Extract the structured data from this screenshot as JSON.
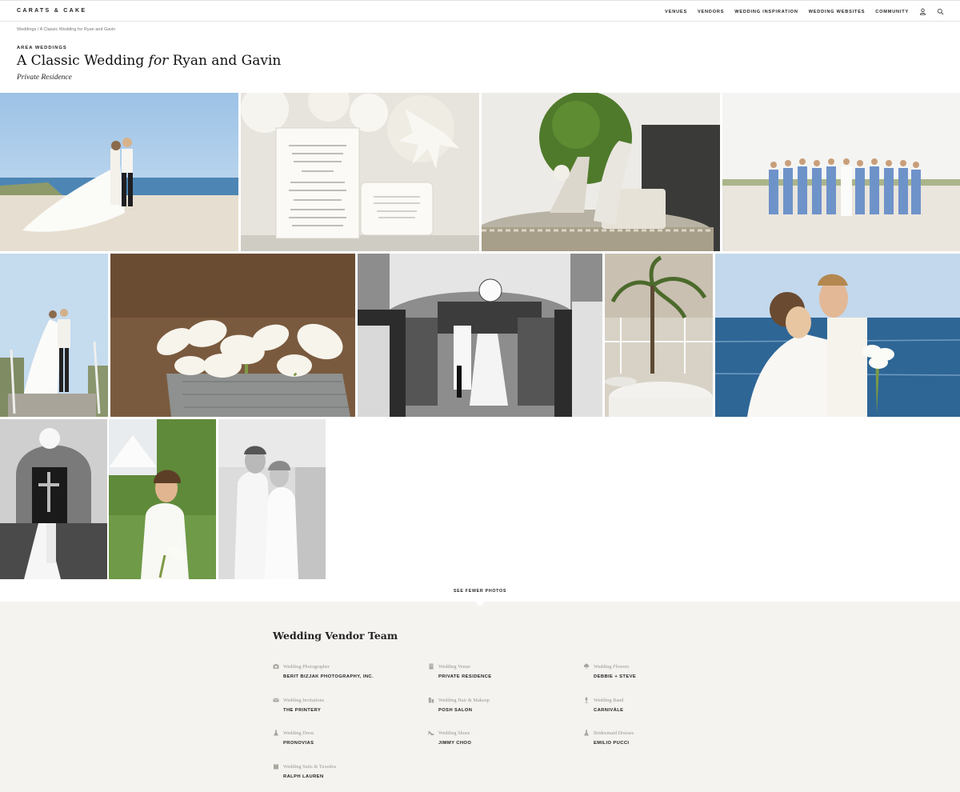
{
  "header": {
    "logo": "CARATS & CAKE",
    "nav": [
      "VENUES",
      "VENDORS",
      "WEDDING INSPIRATION",
      "WEDDING WEBSITES",
      "COMMUNITY"
    ],
    "icons": [
      "user-icon",
      "search-icon"
    ]
  },
  "breadcrumb": {
    "root": "Weddings",
    "separator": "/",
    "current": "A Classic Wedding for Ryan and Gavin"
  },
  "article": {
    "kicker": "AREA WEDDINGS",
    "title_before": "A Classic Wedding ",
    "title_italic": "for",
    "title_after": " Ryan and Gavin",
    "location": "Private Residence"
  },
  "gallery": {
    "toggle_label": "SEE FEWER PHOTOS",
    "photos": [
      "beach couple with flowing cape",
      "wedding invitation suite with coral",
      "embellished heels on mirrored tray",
      "bridesmaids in blue dresses on beach",
      "couple on beach stairs",
      "white calla lily bouquet",
      "black and white church recessional",
      "tent reception tables with palm",
      "couple kissing by the ocean",
      "black and white church altar",
      "bride portrait in garden",
      "black and white couple dancing"
    ]
  },
  "vendors": {
    "heading": "Wedding Vendor Team",
    "items": [
      {
        "role": "Wedding Photographer",
        "name": "BERIT BIZJAK PHOTOGRAPHY, INC.",
        "icon": "camera-icon"
      },
      {
        "role": "Wedding Venue",
        "name": "PRIVATE RESIDENCE",
        "icon": "building-icon"
      },
      {
        "role": "Wedding Flowers",
        "name": "DEBBIE + STEVE",
        "icon": "flower-icon"
      },
      {
        "role": "Wedding Invitations",
        "name": "THE PRINTERY",
        "icon": "envelope-icon"
      },
      {
        "role": "Wedding Hair & Makeup",
        "name": "POSH SALON",
        "icon": "makeup-icon"
      },
      {
        "role": "Wedding Band",
        "name": "CARNIVÀLE",
        "icon": "microphone-icon"
      },
      {
        "role": "Wedding Dress",
        "name": "PRONOVIAS",
        "icon": "dress-icon"
      },
      {
        "role": "Wedding Shoes",
        "name": "JIMMY CHOO",
        "icon": "shoe-icon"
      },
      {
        "role": "Bridesmaid Dresses",
        "name": "EMILIO PUCCI",
        "icon": "dress-icon"
      },
      {
        "role": "Wedding Suits & Tuxedos",
        "name": "RALPH LAUREN",
        "icon": "suit-icon"
      }
    ]
  }
}
